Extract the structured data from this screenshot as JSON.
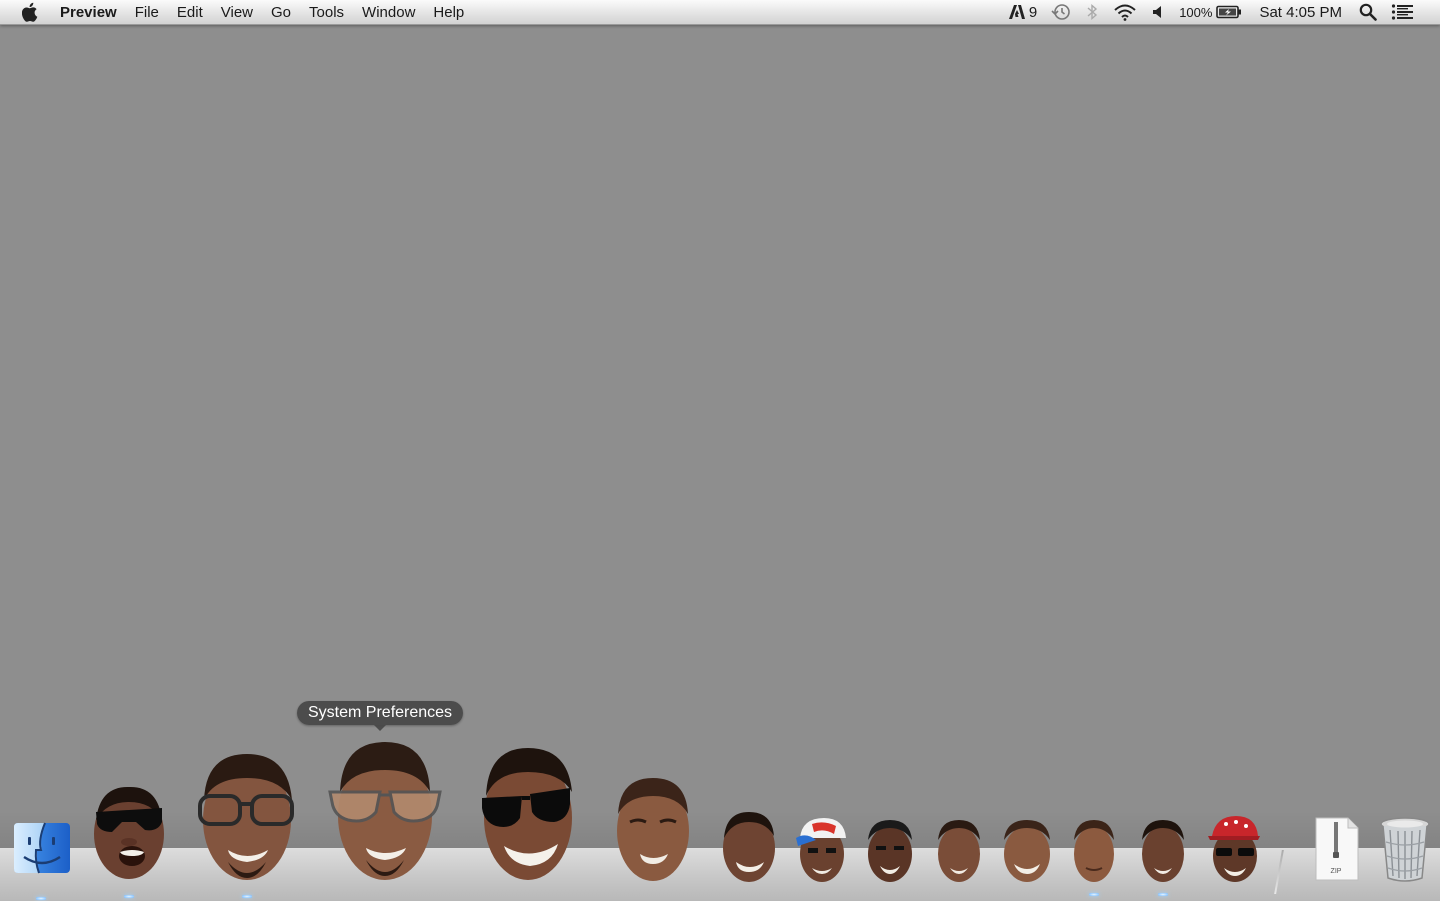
{
  "menubar": {
    "app_name": "Preview",
    "menus": [
      "File",
      "Edit",
      "View",
      "Go",
      "Tools",
      "Window",
      "Help"
    ],
    "status": {
      "adobe_badge": "9",
      "battery_percent": "100%",
      "clock": "Sat 4:05 PM"
    }
  },
  "tooltip": {
    "text": "System Preferences"
  },
  "dock": {
    "zip_label": "ZIP"
  },
  "colors": {
    "desktop": "#8e8e8e",
    "tooltip_bg": "#464646"
  }
}
